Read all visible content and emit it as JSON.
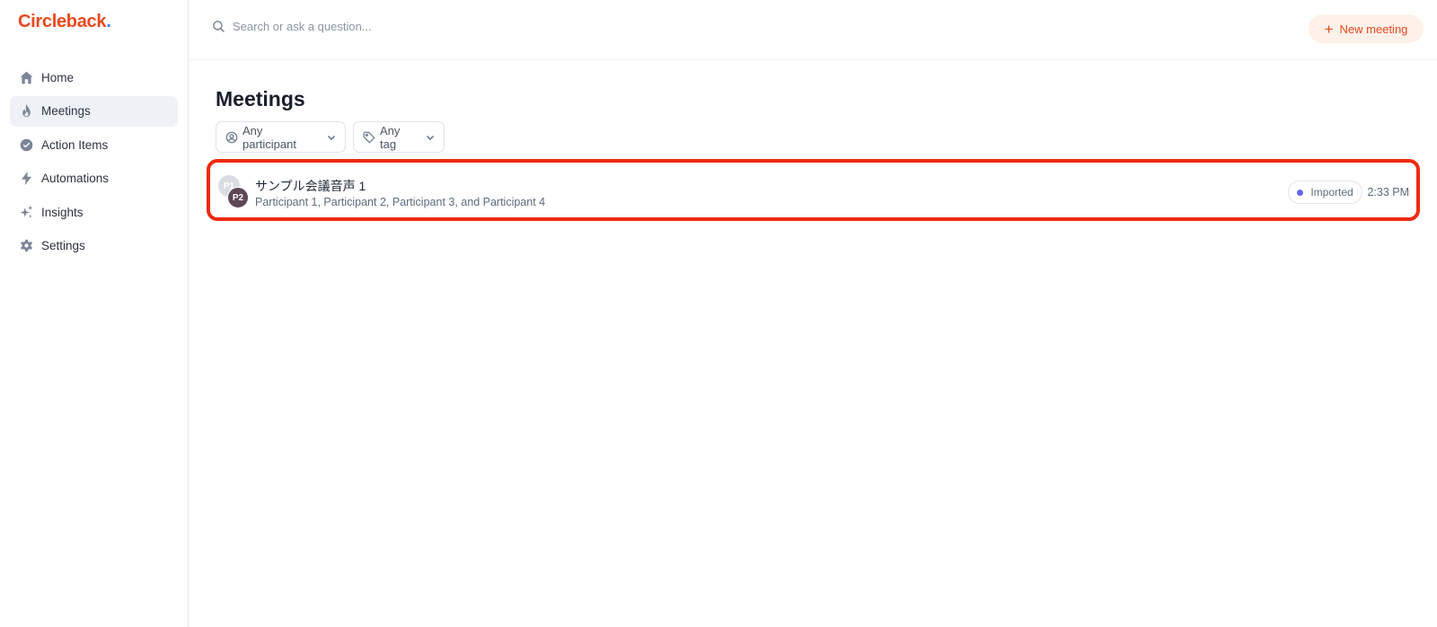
{
  "app": {
    "logo_text": "Circleback",
    "logo_dot": ".",
    "brand_color": "#e8491d"
  },
  "sidebar": {
    "items": [
      {
        "label": "Home",
        "icon": "home-icon",
        "active": false
      },
      {
        "label": "Meetings",
        "icon": "flame-icon",
        "active": true
      },
      {
        "label": "Action Items",
        "icon": "check-circle-icon",
        "active": false
      },
      {
        "label": "Automations",
        "icon": "lightning-icon",
        "active": false
      },
      {
        "label": "Insights",
        "icon": "sparkles-icon",
        "active": false
      },
      {
        "label": "Settings",
        "icon": "gear-icon",
        "active": false
      }
    ]
  },
  "topbar": {
    "search_placeholder": "Search or ask a question...",
    "new_meeting_label": "New meeting",
    "new_meeting_icon": "plus-icon"
  },
  "main": {
    "title": "Meetings",
    "filters": {
      "participant_label": "Any participant",
      "tag_label": "Any tag"
    },
    "meetings": [
      {
        "title": "サンプル会議音声 1",
        "participants": "Participant 1, Participant 2, Participant 3, and Participant 4",
        "avatars": [
          "P1",
          "P2"
        ],
        "badge": "Imported",
        "badge_dot_color": "#6366f1",
        "time": "2:33 PM",
        "highlight_color": "#ee2a11"
      }
    ]
  }
}
